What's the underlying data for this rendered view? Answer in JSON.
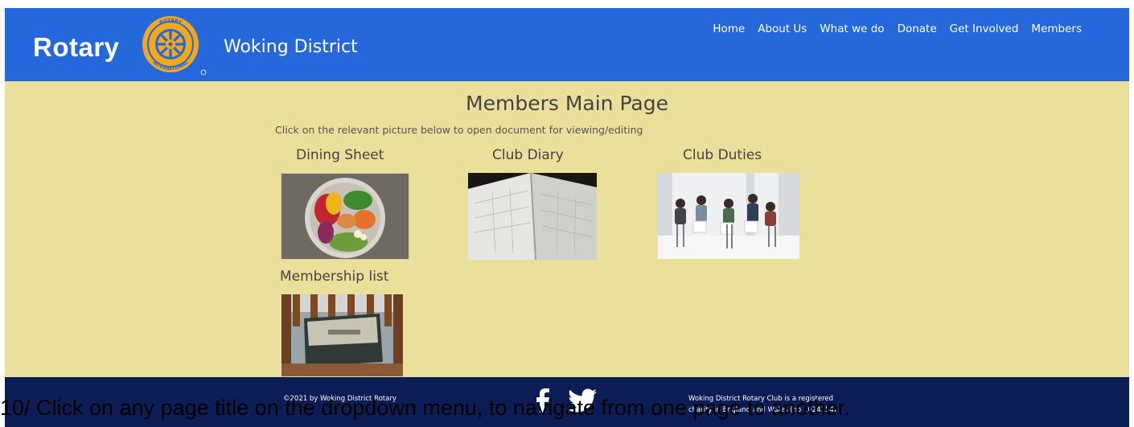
{
  "header": {
    "brand": "Rotary",
    "district": "Woking District",
    "logo_ring_top": "ROTARY",
    "logo_ring_bottom": "INTERNATIONAL",
    "nav": [
      "Home",
      "About Us",
      "What we do",
      "Donate",
      "Get Involved",
      "Members"
    ]
  },
  "main": {
    "title": "Members Main Page",
    "intro": "Click on the relevant picture below to open document for viewing/editing",
    "tiles": [
      {
        "title": "Dining Sheet"
      },
      {
        "title": "Club Diary"
      },
      {
        "title": "Club Duties"
      },
      {
        "title": "Membership list"
      }
    ]
  },
  "footer": {
    "copyright": "©2021 by Woking District Rotary",
    "charity_line1": "Woking District Rotary Club is a registered",
    "charity_line2": "charity in England and Wales (no 1024154)",
    "social": [
      "facebook-icon",
      "twitter-icon"
    ]
  },
  "caption": "10/ Click on any page title on the dropdown menu, to navigate from one page to another.",
  "colors": {
    "header_bg": "#2468dc",
    "page_bg": "#eadf9b",
    "footer_bg": "#0c1d55",
    "logo_gold": "#f3a81c"
  }
}
